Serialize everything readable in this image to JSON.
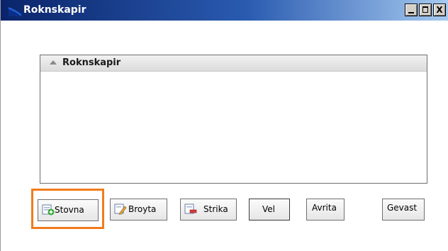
{
  "window": {
    "title": "Roknskapir",
    "controls": {
      "minimize": "_",
      "maximize": "□",
      "close": "X"
    }
  },
  "list": {
    "header": "Roknskapir",
    "rows": []
  },
  "buttons": {
    "add": "Stovna",
    "edit": "Broyta",
    "delete": "Strika",
    "select": "Vel",
    "cancel": "Avrita",
    "close": "Gevast"
  },
  "highlight_target": "add",
  "colors": {
    "titlebar_start": "#0a246a",
    "titlebar_end": "#a6caf0",
    "highlight": "#f07c1c"
  }
}
